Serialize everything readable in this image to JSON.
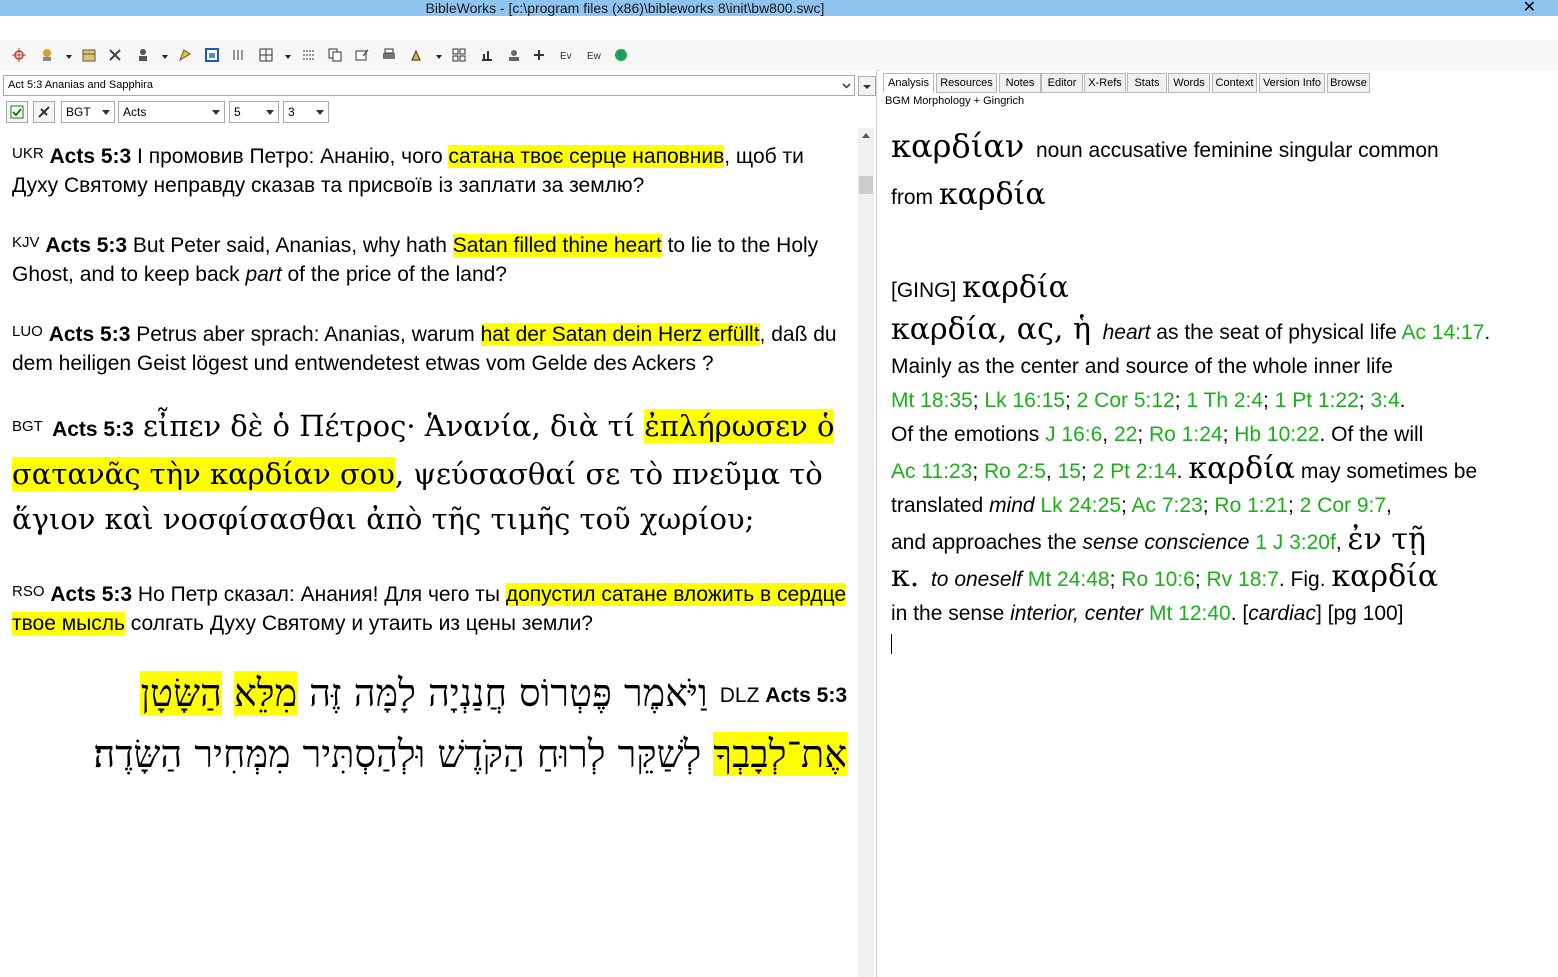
{
  "window": {
    "title": "BibleWorks - [c:\\program files (x86)\\bibleworks 8\\init\\bw800.swc]",
    "close_glyph": "✕"
  },
  "left": {
    "reference": "Act 5:3 Ananias and Sapphira",
    "version": "BGT",
    "book": "Acts",
    "chapter": "5",
    "verse": "3",
    "verses": [
      {
        "version": "UKR",
        "ref": "Acts 5:3",
        "pre": " І промовив Петро: Ананію, чого ",
        "hl": "сатана твоє серце наповнив",
        "post": ", щоб ти Духу Святому неправду сказав та присвоїв із заплати за землю?"
      },
      {
        "version": "KJV",
        "ref": "Acts 5:3",
        "pre": " But Peter said, Ananias, why hath ",
        "hl": "Satan filled thine heart",
        "post_a": " to lie to the Holy Ghost, and to keep back ",
        "italic": "part",
        "post_b": " of the price of the land?"
      },
      {
        "version": "LUO",
        "ref": "Acts 5:3",
        "pre": " Petrus aber sprach: Ananias, warum ",
        "hl": "hat der Satan dein Herz erfüllt",
        "post": ", daß du dem heiligen Geist lögest und entwendetest etwas vom Gelde des Ackers ?"
      },
      {
        "version": "BGT",
        "ref": "Acts 5:3",
        "line1": " εἶπεν δὲ ὁ Πέτρος· Ἁνανία, διὰ τί",
        "hl": "ἐπλήρωσεν ὁ σατανᾶς τὴν καρδίαν σου",
        "post": ", ψεύσασθαί σε τὸ πνεῦμα τὸ ἅγιον καὶ νοσφίσασθαι ἀπὸ τῆς τιμῆς τοῦ χωρίου;"
      },
      {
        "version": "RSO",
        "ref": "Acts 5:3",
        "pre": " Но Петр сказал: Анания! Для чего ты ",
        "hl": "допустил сатане вложить в сердце твое мысль",
        "post": " солгать Духу Святому и утаить из цены земли?"
      },
      {
        "version": "DLZ",
        "ref": "Acts 5:3",
        "pre": "וַיֹּאמֶר פֶּטְרוֹס חֲנַנְיָה לָמָּה זֶּה ",
        "hl1": "מִלֵּא",
        "hl2": "הַשָּׂטָן אֶת־לְבָבְךָ",
        "post": " לְשַׁקֵּר לְרוּחַ הַקֹּדֶשׁ וּלְהַסְתִּיר מִמְּחִיר הַשָּׂדֶה׃"
      }
    ]
  },
  "right": {
    "tabs": [
      "Analysis",
      "Resources",
      "Notes",
      "Editor",
      "X-Refs",
      "Stats",
      "Words",
      "Context",
      "Version Info",
      "Browse"
    ],
    "subtitle": "BGM Morphology + Gingrich",
    "word": "καρδίαν",
    "parse": "noun accusative feminine singular common",
    "from_label": "from",
    "lemma": "καρδία",
    "ging_tag": "[GING]",
    "ging_lemma": "καρδία",
    "entry_lemma": "καρδία",
    "entry_forms": ", ας, ἡ",
    "heart": "heart",
    "seat": " as the seat of physical life ",
    "ref_ac1417": "Ac 14:17",
    "mainly": ". Mainly as the center and source of the whole inner life ",
    "refs1": [
      "Mt 18:35",
      "Lk 16:15",
      "2 Cor 5:12",
      "1 Th 2:4",
      "1 Pt 1:22",
      "3:4"
    ],
    "emotions": "Of the emotions ",
    "refs2": [
      "J 16:6",
      "22",
      "Ro 1:24",
      "Hb 10:22"
    ],
    "will": ". Of the will ",
    "refs3": [
      "Ac 11:23",
      "Ro 2:5",
      "15",
      "2 Pt 2:14"
    ],
    "kardia2": "καρδία",
    "may": " may sometimes be translated ",
    "mind": "mind",
    "refs4": [
      "Lk 24:25",
      "Ac 7:23",
      "Ro 1:21",
      "2 Cor 9:7"
    ],
    "approaches": "and approaches the ",
    "sense": "sense conscience",
    "ref_1j": "1 J 3:20f",
    "en_te": "ἐν τῇ",
    "kappa": "κ.",
    "oneself": "to oneself",
    "refs5": [
      "Mt 24:48",
      "Ro 10:6",
      "Rv 18:7"
    ],
    "fig": ". Fig.",
    "kardia3": "καρδία",
    "in_sense": "in the sense ",
    "interior": "interior, center",
    "ref_mt1240": "Mt 12:40",
    "tail_a": ". [",
    "cardiac": "cardiac",
    "tail_b": "] [pg 100]"
  }
}
